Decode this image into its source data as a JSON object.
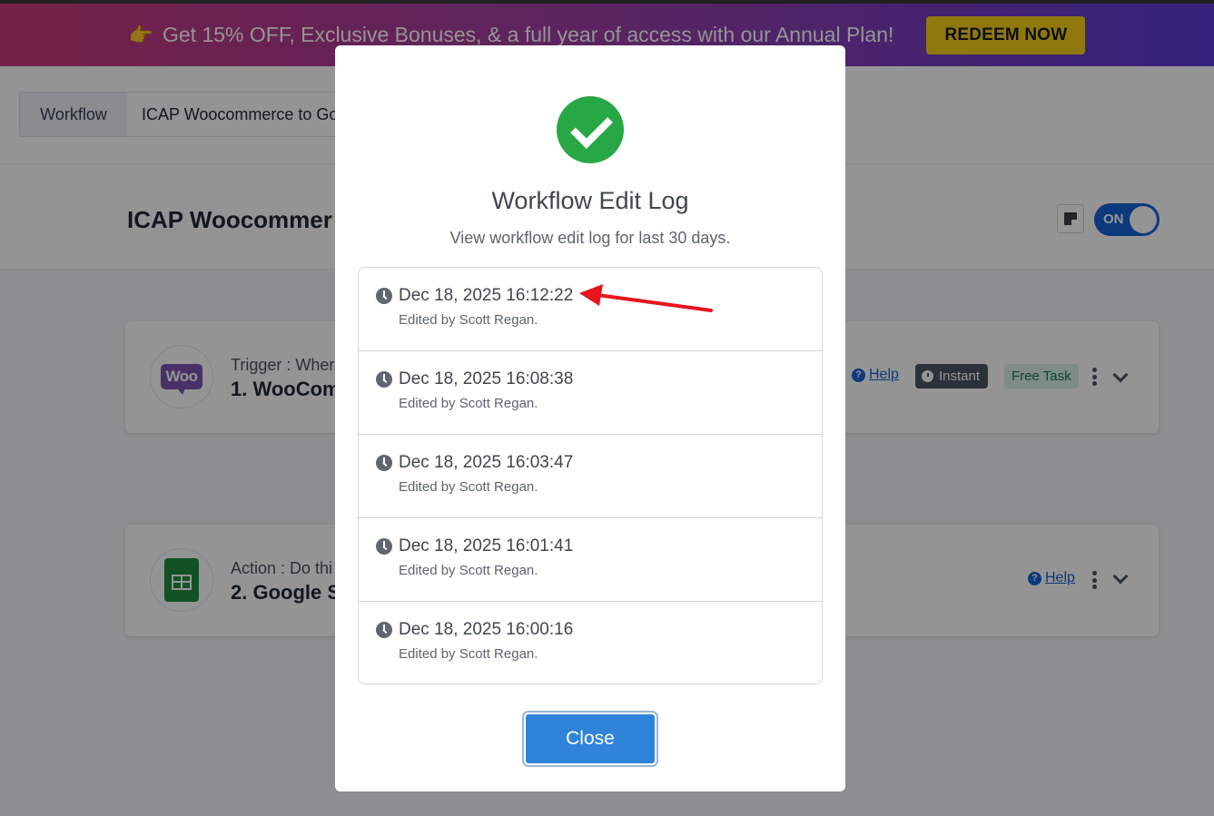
{
  "promo": {
    "icon": "pointing-hand-icon",
    "text": "Get 15% OFF, Exclusive Bonuses, & a full year of access with our Annual Plan!",
    "cta": "REDEEM NOW"
  },
  "breadcrumb": {
    "tab": "Workflow",
    "name": "ICAP Woocommerce to Go"
  },
  "header": {
    "title": "ICAP Woocommer",
    "toggle_label": "ON"
  },
  "steps": [
    {
      "kind": "Trigger : Wher",
      "name": "1. WooCom",
      "logo_text": "Woo",
      "help": "Help",
      "instant": "Instant",
      "free_task": "Free Task"
    },
    {
      "kind": "Action : Do thi",
      "name": "2. Google S",
      "help": "Help"
    }
  ],
  "modal": {
    "title": "Workflow Edit Log",
    "subtitle": "View workflow edit log for last 30 days.",
    "entries": [
      {
        "time": "Dec 18, 2025 16:12:22",
        "user": "Edited by Scott Regan."
      },
      {
        "time": "Dec 18, 2025 16:08:38",
        "user": "Edited by Scott Regan."
      },
      {
        "time": "Dec 18, 2025 16:03:47",
        "user": "Edited by Scott Regan."
      },
      {
        "time": "Dec 18, 2025 16:01:41",
        "user": "Edited by Scott Regan."
      },
      {
        "time": "Dec 18, 2025 16:00:16",
        "user": "Edited by Scott Regan."
      }
    ],
    "close_label": "Close"
  },
  "colors": {
    "primary": "#1663d6",
    "success": "#28a745",
    "promo_cta": "#f7d11a",
    "annotation_arrow": "#e8141e"
  }
}
